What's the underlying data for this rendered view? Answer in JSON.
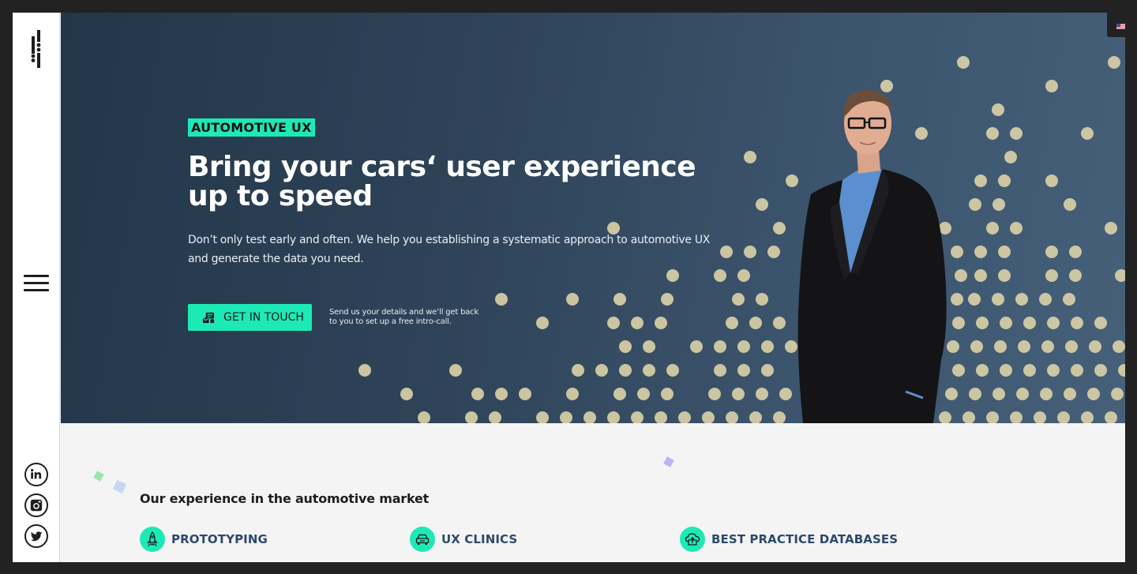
{
  "brand": {
    "accent": "#1de9b6",
    "hero_bg": "#2f4459",
    "dot_color": "#d8cfa6",
    "heading_blue": "#2c4a6b"
  },
  "sidebar": {
    "logo_icon": "brand-logo-icon",
    "menu_icon": "hamburger-menu-icon",
    "social": [
      {
        "name": "linkedin",
        "icon": "linkedin-icon"
      },
      {
        "name": "instagram",
        "icon": "instagram-icon"
      },
      {
        "name": "twitter",
        "icon": "twitter-icon"
      }
    ]
  },
  "language": {
    "icon": "us-flag-icon",
    "value": "English (US)"
  },
  "hero": {
    "tag": "AUTOMOTIVE UX",
    "headline": "Bring your cars‘ user experience up to speed",
    "lead": "Don’t only test early and often. We help you establishing a systematic approach to automotive UX and generate the data you need.",
    "cta_label": "GET IN TOUCH",
    "cta_icon": "contact-card-icon",
    "cta_note": "Send us your details and we’ll get back to you to set up a free intro-call.",
    "image": "portrait-of-man-in-suit"
  },
  "experience": {
    "title": "Our experience in the automotive market",
    "features": [
      {
        "label": "PROTOTYPING",
        "icon": "rocket-icon"
      },
      {
        "label": "UX CLINICS",
        "icon": "car-icon"
      },
      {
        "label": "BEST PRACTICE DATABASES",
        "icon": "cloud-database-icon"
      }
    ]
  }
}
